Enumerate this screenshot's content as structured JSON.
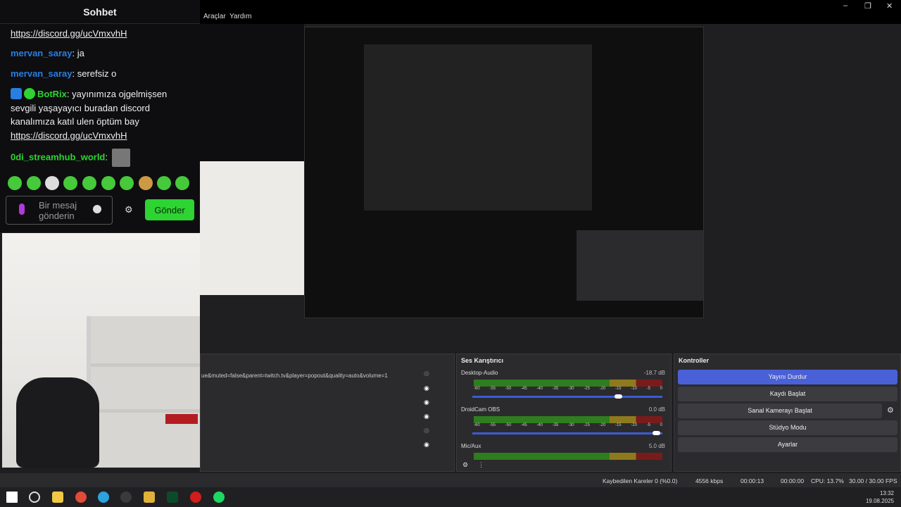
{
  "chat": {
    "title": "Sohbet",
    "messages": [
      {
        "user": "",
        "text": "https://discord.gg/ucVmxvhH"
      },
      {
        "user": "mervan_saray",
        "text": ": ja"
      },
      {
        "user": "mervan_saray",
        "text": ": serefsiz o"
      },
      {
        "user": "BotRix",
        "text": ": yayınımıza ojgelmişsen sevgili yaşayayıcı buradan discord kanalımıza katıl ulen öptüm bay"
      },
      {
        "user": "",
        "text": "https://discord.gg/ucVmxvhH"
      },
      {
        "user": "0di_streamhub_world",
        "text": ":"
      }
    ],
    "input_placeholder": "Bir mesaj gönderin",
    "send_label": "Gönder",
    "user_colors": {
      "mervan_saray": "#2a7de1",
      "BotRix": "#2dd432",
      "0di_streamhub_world": "#2dd432"
    }
  },
  "menu": {
    "tools": "Araçlar",
    "help": "Yardım"
  },
  "sources": {
    "url_text": "ue&muted=false&parent=twitch.tv&player=popout&quality=auto&volume=1"
  },
  "mixer": {
    "title": "Ses Karıştırıcı",
    "channels": [
      {
        "name": "Desktop-Audio",
        "db": "-18.7 dB",
        "level": 0.78
      },
      {
        "name": "DroidCam OBS",
        "db": "0.0 dB",
        "level": 0.99
      },
      {
        "name": "Mic/Aux",
        "db": "5.0 dB",
        "level": 0.35
      }
    ],
    "ticks": [
      "-60",
      "-55",
      "-50",
      "-45",
      "-40",
      "-35",
      "-30",
      "-25",
      "-20",
      "-15",
      "-10",
      "-5",
      "0"
    ]
  },
  "controls": {
    "title": "Kontroller",
    "buttons": [
      "Yayını Durdur",
      "Kaydı Başlat",
      "Sanal Kamerayı Başlat",
      "Stüdyo Modu",
      "Ayarlar"
    ]
  },
  "status": {
    "dropped": "Kaybedilen Kareler 0 (%0.0)",
    "bitrate": "4556 kbps",
    "stream_time": "00:00:13",
    "rec_time": "00:00:00",
    "cpu": "CPU: 13.7%",
    "fps": "30.00 / 30.00 FPS"
  },
  "clock": {
    "time": "13:32",
    "date": "19.08.2025"
  }
}
